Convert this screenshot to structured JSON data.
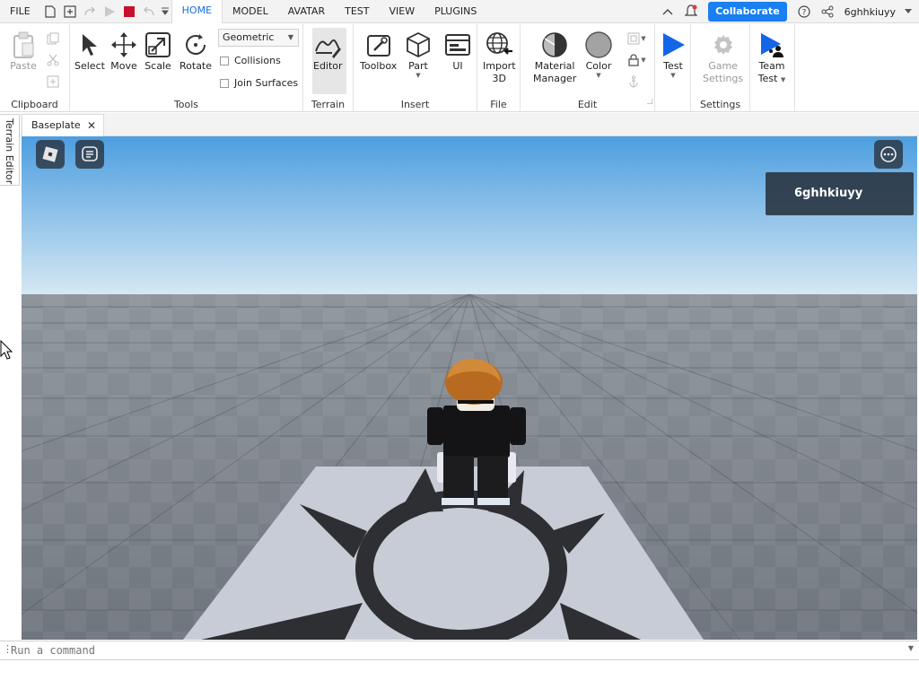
{
  "menu": {
    "items": [
      "FILE",
      "HOME",
      "MODEL",
      "AVATAR",
      "TEST",
      "VIEW",
      "PLUGINS"
    ],
    "active": "HOME",
    "collaborate_label": "Collaborate",
    "user_name": "6ghhkiuyy"
  },
  "ribbon": {
    "clipboard": {
      "label": "Clipboard",
      "paste": "Paste"
    },
    "tools": {
      "label": "Tools",
      "select": "Select",
      "move": "Move",
      "scale": "Scale",
      "rotate": "Rotate",
      "mode_value": "Geometric",
      "collisions": "Collisions",
      "join_surfaces": "Join Surfaces"
    },
    "terrain": {
      "label": "Terrain",
      "editor": "Editor"
    },
    "insert": {
      "label": "Insert",
      "toolbox": "Toolbox",
      "part": "Part",
      "ui": "UI"
    },
    "file": {
      "label": "File",
      "import_line1": "Import",
      "import_line2": "3D"
    },
    "edit": {
      "label": "Edit",
      "material_line1": "Material",
      "material_line2": "Manager",
      "color": "Color"
    },
    "test": {
      "test": "Test"
    },
    "settings": {
      "label": "Settings",
      "game_line1": "Game",
      "game_line2": "Settings"
    },
    "team": {
      "line1": "Team",
      "line2": "Test"
    }
  },
  "side_tab": "Terrain Editor",
  "doc_tab": "Baseplate",
  "viewport": {
    "player_name": "6ghhkiuyy"
  },
  "command": {
    "placeholder": "Run a command"
  },
  "colors": {
    "accent": "#1a7ff0",
    "active_menu": "#1a6cd6",
    "stop_red": "#c8102e",
    "test_blue": "#1565e8"
  }
}
